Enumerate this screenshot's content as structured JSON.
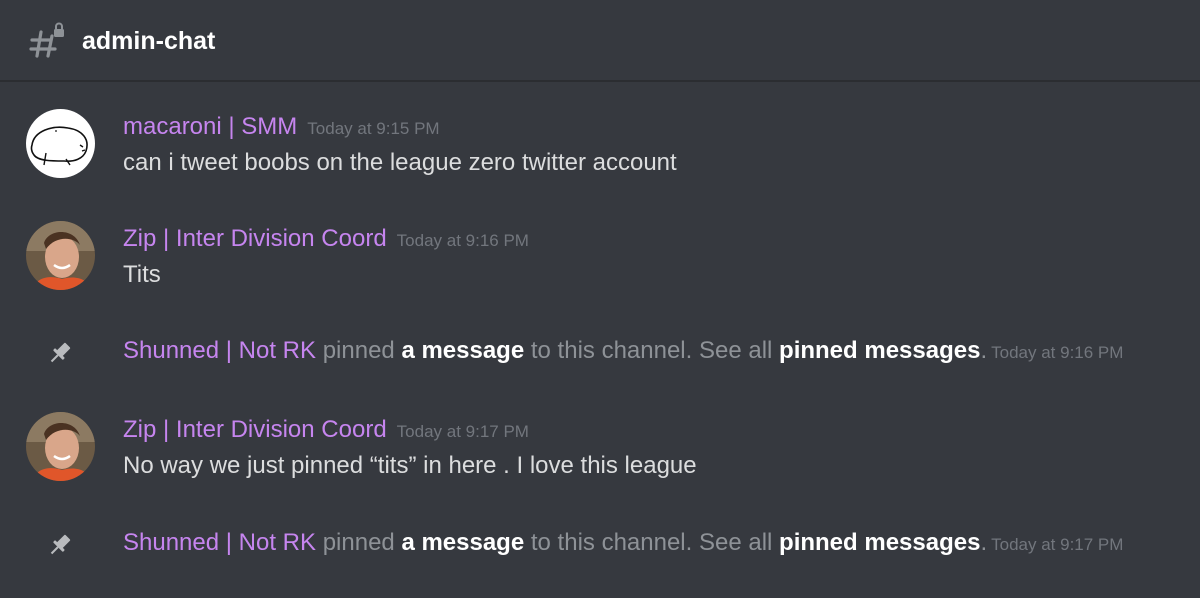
{
  "channel": {
    "name": "admin-chat",
    "icon": "locked-hash-icon"
  },
  "messages": [
    {
      "username": "macaroni | SMM",
      "timestamp": "Today at 9:15 PM",
      "content": "can i tweet boobs on the league zero twitter account",
      "avatar": "doodle-avatar"
    },
    {
      "username": "Zip | Inter Division Coord",
      "timestamp": "Today at 9:16 PM",
      "content": "Tits",
      "avatar": "photo-avatar"
    },
    {
      "username": "Zip | Inter Division Coord",
      "timestamp": "Today at 9:17 PM",
      "content": "No way we just pinned “tits” in here . I love this league",
      "avatar": "photo-avatar"
    }
  ],
  "system_messages": [
    {
      "actor": "Shunned | Not RK",
      "text1": " pinned ",
      "link1": "a message",
      "text2": " to this channel. See all ",
      "link2": "pinned messages",
      "text3": ".",
      "timestamp": "Today at 9:16 PM",
      "icon": "pin-icon"
    },
    {
      "actor": "Shunned | Not RK",
      "text1": " pinned ",
      "link1": "a message",
      "text2": " to this channel. See all ",
      "link2": "pinned messages",
      "text3": ".",
      "timestamp": "Today at 9:17 PM",
      "icon": "pin-icon"
    }
  ],
  "colors": {
    "background": "#36393f",
    "username": "#c685ef",
    "timestamp": "#72767d",
    "text": "#dcddde",
    "system_text": "#8e9297"
  }
}
